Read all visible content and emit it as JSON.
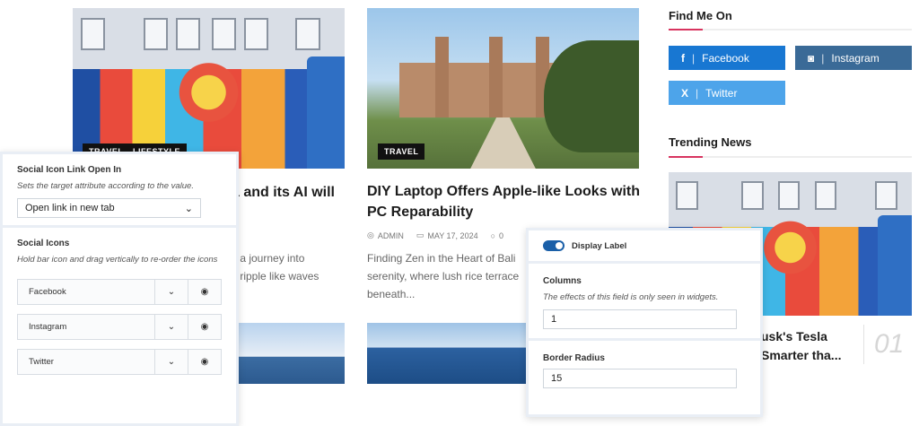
{
  "posts": [
    {
      "tags": [
        "TRAVEL",
        "LIFESTYLE"
      ],
      "title_line1": "a and its AI will",
      "excerpt_line1": "s a journey into",
      "excerpt_line2": "s ripple like waves"
    },
    {
      "tag": "TRAVEL",
      "title": "DIY Laptop Offers Apple-like Looks with PC Reparability",
      "author": "ADMIN",
      "date": "MAY 17, 2024",
      "comments": "0",
      "excerpt": "Finding Zen in the Heart of Bali serenity, where lush rice terrace beneath..."
    }
  ],
  "sidebar": {
    "find_me": "Find Me On",
    "socials": [
      {
        "icon": "facebook-icon",
        "label": "Facebook",
        "color": "#1877d2"
      },
      {
        "icon": "instagram-icon",
        "label": "Instagram",
        "color": "#3a6a97"
      },
      {
        "icon": "x-icon",
        "label": "Twitter",
        "color": "#4da4ea"
      }
    ],
    "trending": "Trending News",
    "trend_title_line1": "usk's Tesla",
    "trend_title_line2": "Smarter tha...",
    "trend_number": "01"
  },
  "panel_left": {
    "link_title": "Social Icon Link Open In",
    "link_desc": "Sets the target attribute according to the value.",
    "link_value": "Open link in new tab",
    "icons_title": "Social Icons",
    "icons_desc": "Hold bar icon and drag vertically to re-order the icons",
    "items": [
      "Facebook",
      "Instagram",
      "Twitter"
    ]
  },
  "panel_right": {
    "display_label": "Display Label",
    "columns_title": "Columns",
    "columns_desc": "The effects of this field is only seen in widgets.",
    "columns_value": "1",
    "radius_title": "Border Radius",
    "radius_value": "15"
  }
}
